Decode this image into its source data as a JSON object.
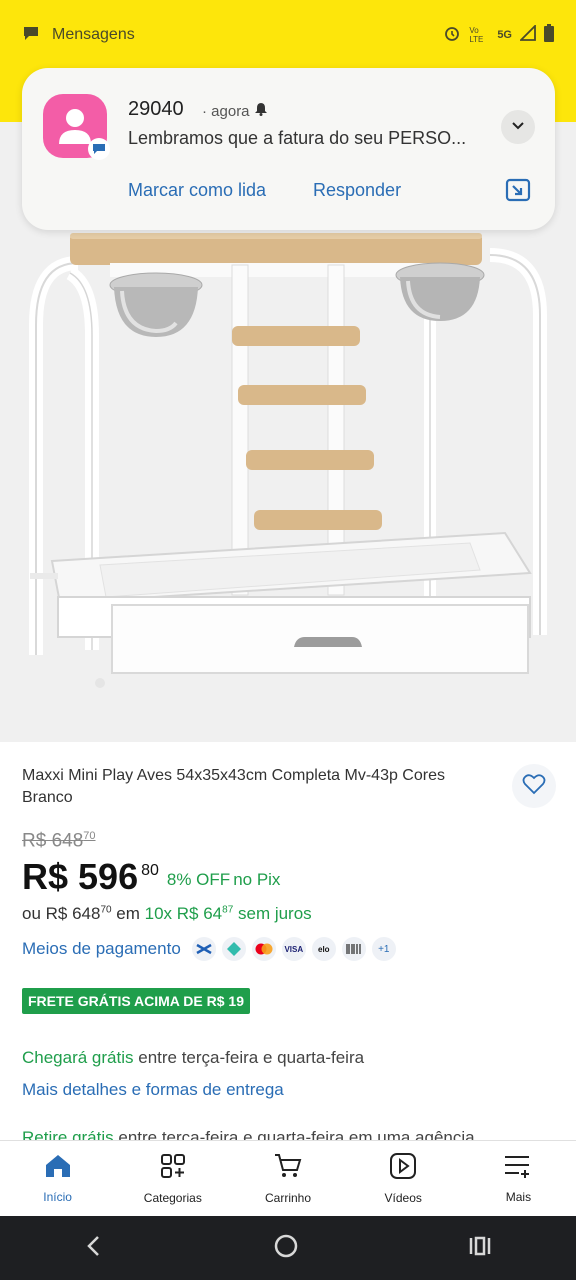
{
  "status_bar": {
    "app_label": "Mensagens",
    "network": "5G",
    "volte": "Vo LTE",
    "icons": [
      "message-icon",
      "alarm-icon",
      "signal-icon",
      "battery-icon"
    ]
  },
  "notification": {
    "sender": "29040",
    "time": "· agora",
    "message": "Lembramos que a fatura do seu PERSO...",
    "mark_read_label": "Marcar como lida",
    "reply_label": "Responder",
    "icon_color": "#f35da7"
  },
  "product": {
    "title": "Maxxi Mini Play Aves 54x35x43cm Completa Mv-43p Cores Branco",
    "old_price": "R$ 648",
    "old_price_cents": "70",
    "price": "R$ 596",
    "price_cents": "80",
    "discount": "8% OFF",
    "discount_suffix": "no Pix",
    "installment_prefix": "ou R$ 648",
    "installment_prefix_cents": "70",
    "installment_mid": " em ",
    "installment_green": "10x R$ 64",
    "installment_green_cents": "87",
    "installment_suffix": " sem juros",
    "payment_label": "Meios de pagamento",
    "payment_methods": [
      "Caixa",
      "Pix",
      "Mastercard",
      "VISA",
      "elo",
      "Boleto",
      "+1"
    ],
    "free_shipping_badge": "FRETE GRÁTIS ACIMA DE R$ 19",
    "arrival_green": "Chegará grátis",
    "arrival_rest": " entre terça-feira e quarta-feira",
    "more_details_link": "Mais detalhes e formas de entrega",
    "pickup_green": "Retire grátis",
    "pickup_rest": " entre terça-feira e quarta-feira em uma agência"
  },
  "bottom_nav": [
    {
      "label": "Início",
      "icon": "home-icon"
    },
    {
      "label": "Categorias",
      "icon": "categories-icon"
    },
    {
      "label": "Carrinho",
      "icon": "cart-icon"
    },
    {
      "label": "Vídeos",
      "icon": "video-icon"
    },
    {
      "label": "Mais",
      "icon": "menu-more-icon"
    }
  ],
  "colors": {
    "header_yellow": "#fde60b",
    "link_blue": "#2a6db5",
    "success_green": "#1f9e4b"
  }
}
